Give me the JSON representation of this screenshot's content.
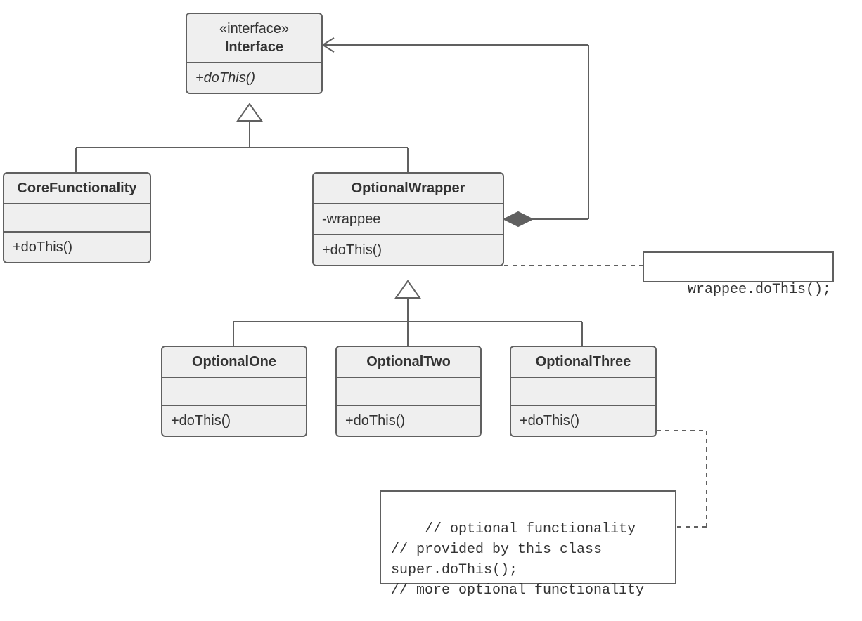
{
  "interface": {
    "stereotype": "«interface»",
    "name": "Interface",
    "method": "+doThis()"
  },
  "coreFunctionality": {
    "name": "CoreFunctionality",
    "method": "+doThis()"
  },
  "optionalWrapper": {
    "name": "OptionalWrapper",
    "attr": "-wrappee",
    "method": "+doThis()"
  },
  "optionalOne": {
    "name": "OptionalOne",
    "method": "+doThis()"
  },
  "optionalTwo": {
    "name": "OptionalTwo",
    "method": "+doThis()"
  },
  "optionalThree": {
    "name": "OptionalThree",
    "method": "+doThis()"
  },
  "notes": {
    "wrappee": "wrappee.doThis();",
    "optional": "// optional functionality\n// provided by this class\nsuper.doThis();\n// more optional functionality"
  },
  "relations": {
    "interface_generalizes": [
      "CoreFunctionality",
      "OptionalWrapper"
    ],
    "optionalWrapper_generalizes": [
      "OptionalOne",
      "OptionalTwo",
      "OptionalThree"
    ],
    "optionalWrapper_aggregates": "Interface",
    "note_wrappee_attached_to": "OptionalWrapper.+doThis()",
    "note_optional_attached_to": "OptionalThree.+doThis()"
  }
}
